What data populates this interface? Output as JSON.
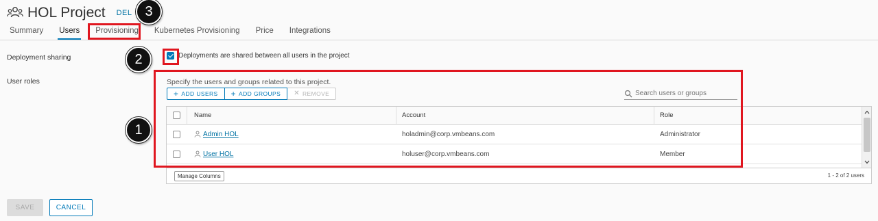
{
  "header": {
    "title": "HOL Project",
    "delete_link": "DEL",
    "icon": "users-group-icon"
  },
  "tabs": [
    {
      "label": "Summary"
    },
    {
      "label": "Users",
      "active": true
    },
    {
      "label": "Provisioning"
    },
    {
      "label": "Kubernetes Provisioning"
    },
    {
      "label": "Price"
    },
    {
      "label": "Integrations"
    }
  ],
  "deployment_sharing": {
    "label": "Deployment sharing",
    "checkbox_text": "Deployments are shared between all users in the project",
    "checked": true
  },
  "user_roles": {
    "label": "User roles",
    "description": "Specify the users and groups related to this project.",
    "buttons": {
      "add_users": "ADD USERS",
      "add_groups": "ADD GROUPS",
      "remove": "REMOVE"
    },
    "search": {
      "placeholder": "Search users or groups"
    },
    "table": {
      "columns": [
        "Name",
        "Account",
        "Role"
      ],
      "rows": [
        {
          "name": "Admin HOL",
          "account": "holadmin@corp.vmbeans.com",
          "role": "Administrator"
        },
        {
          "name": "User HOL",
          "account": "holuser@corp.vmbeans.com",
          "role": "Member"
        }
      ],
      "manage_columns": "Manage Columns",
      "pagination": "1 - 2 of 2 users"
    }
  },
  "footer": {
    "save": "SAVE",
    "cancel": "CANCEL"
  },
  "callouts": [
    "1",
    "2",
    "3"
  ],
  "colors": {
    "accent": "#0079b8",
    "annotation_red": "#e0161f",
    "callout_fill": "#111111"
  }
}
